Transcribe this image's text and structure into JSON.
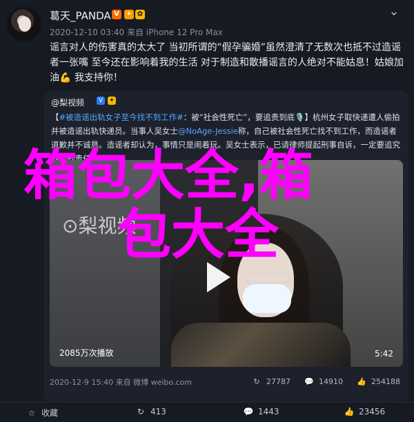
{
  "post": {
    "author_name": "葛天_PANDA",
    "badges": [
      "V",
      "✦",
      "✿"
    ],
    "meta": "2020-12-10 03:40 来自 iPhone 12 Pro Max",
    "body": "谣言对人的伤害真的太大了 当初所谓的“假孕骗婚”虽然澄清了无数次也抵不过造谣者一张嘴 至今还在影响着我的生活 对于制造和散播谣言的人绝对不能姑息！姑娘加油💪 我支持你！",
    "quote": {
      "author": "@梨视频",
      "text_prefix": "【",
      "hashtag": "#被造谣出轨女子至今找不到工作#",
      "text_mid": "：被“社会性死亡”，要追责到底🎙️】杭州女子取快递遭人偷拍并被造谣出轨快递员。当事人吴女士",
      "mention": "@NoAge-Jessie",
      "text_after": "称，自己被社会性死亡找不到工作，而造谣者道歉并不诚恳。造谣者却认为，事情只是闹着玩。吴女士表示，已请律师提起刑事自诉，一定要追究他们的责任",
      "fullmark": "⊙ 全文",
      "video": {
        "watermark": "⊙梨视频",
        "play_count": "2085万次播放",
        "duration": "5:42"
      },
      "meta": "2020-12-9 15:40 来自 微博 weibo.com",
      "repost_count": "27787",
      "comment_count": "14910",
      "like_count": "254188"
    },
    "bottom": {
      "favorite_label": "收藏",
      "repost_count": "413",
      "comment_count": "1443",
      "like_count": "23456"
    },
    "overlay": {
      "line1": "箱包大全,箱",
      "line2": "包大全"
    },
    "colors": {
      "accent": "#ff00ff",
      "link": "#58a6ff"
    }
  }
}
